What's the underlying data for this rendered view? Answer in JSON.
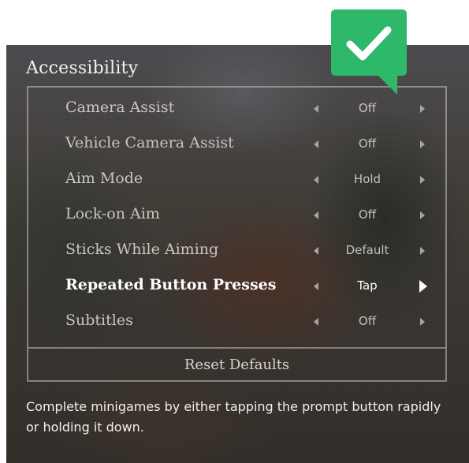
{
  "menu": {
    "title": "Accessibility",
    "items": [
      {
        "label": "Camera Assist",
        "value": "Off"
      },
      {
        "label": "Vehicle Camera Assist",
        "value": "Off"
      },
      {
        "label": "Aim Mode",
        "value": "Hold"
      },
      {
        "label": "Lock-on Aim",
        "value": "Off"
      },
      {
        "label": "Sticks While Aiming",
        "value": "Default"
      },
      {
        "label": "Repeated Button Presses",
        "value": "Tap"
      },
      {
        "label": "Subtitles",
        "value": "Off"
      }
    ],
    "selected_item": "Repeated Button Presses",
    "reset_label": "Reset Defaults"
  },
  "description": "Complete minigames by either tapping the prompt button rapidly or holding it down.",
  "badge": {
    "icon": "checkmark-icon",
    "color": "#2db86a"
  },
  "colors": {
    "text_primary": "#ffffff",
    "text_dim": "#c9c5bf",
    "frame": "#c8c4be"
  }
}
